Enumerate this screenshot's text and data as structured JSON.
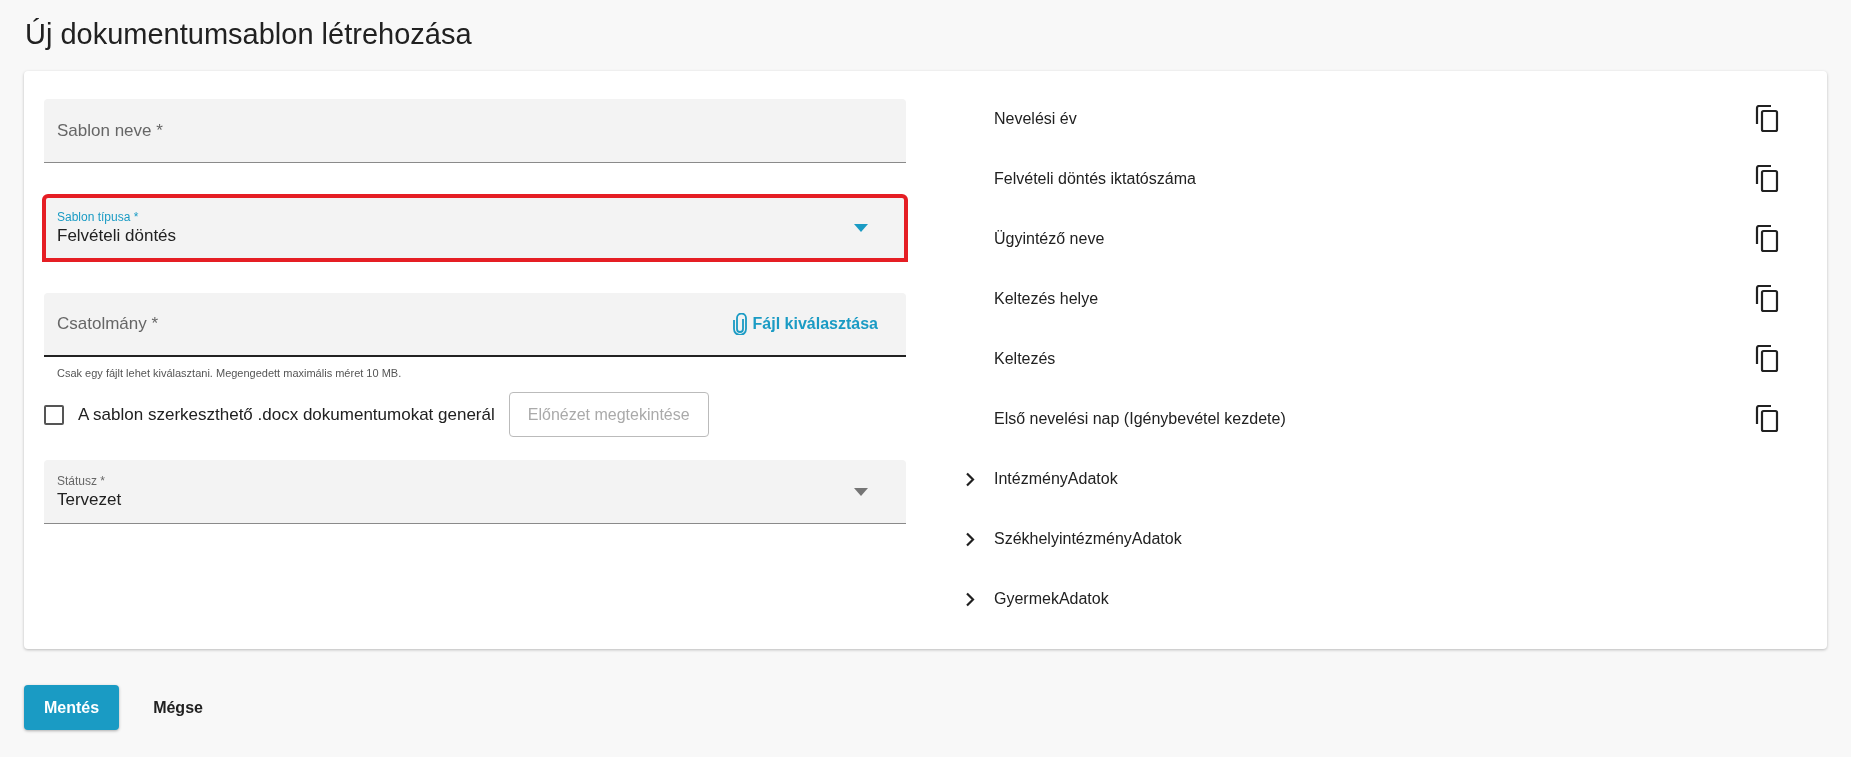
{
  "page_title": "Új dokumentumsablon létrehozása",
  "form": {
    "fields": [
      {
        "kind": "text",
        "label": "Sablon neve *",
        "highlighted": false
      },
      {
        "kind": "select",
        "label": "Sablon típusa *",
        "value": "Felvételi döntés",
        "focused": true,
        "highlighted": true
      },
      {
        "kind": "file",
        "label": "Csatolmány *",
        "action": "Fájl kiválasztása",
        "hint": "Csak egy fájlt lehet kiválasztani. Megengedett maximális méret 10 MB.",
        "highlighted": false
      },
      {
        "kind": "checkbox",
        "label": "A sablon szerkeszthető .docx dokumentumokat generál",
        "checked": false,
        "button": {
          "label": "Előnézet megtekintése",
          "disabled": true
        }
      },
      {
        "kind": "select",
        "label": "Státusz *",
        "value": "Tervezet",
        "focused": false,
        "highlighted": false
      }
    ]
  },
  "placeholders": [
    {
      "kind": "leaf",
      "label": "Nevelési év"
    },
    {
      "kind": "leaf",
      "label": "Felvételi döntés iktatószáma"
    },
    {
      "kind": "leaf",
      "label": "Ügyintéző neve"
    },
    {
      "kind": "leaf",
      "label": "Keltezés helye"
    },
    {
      "kind": "leaf",
      "label": "Keltezés"
    },
    {
      "kind": "leaf",
      "label": "Első nevelési nap (Igénybevétel kezdete)"
    },
    {
      "kind": "group",
      "label": "IntézményAdatok",
      "expanded": false
    },
    {
      "kind": "group",
      "label": "SzékhelyintézményAdatok",
      "expanded": false
    },
    {
      "kind": "group",
      "label": "GyermekAdatok",
      "expanded": false
    }
  ],
  "actions": [
    {
      "kind": "primary",
      "label": "Mentés"
    },
    {
      "kind": "text",
      "label": "Mégse"
    }
  ]
}
